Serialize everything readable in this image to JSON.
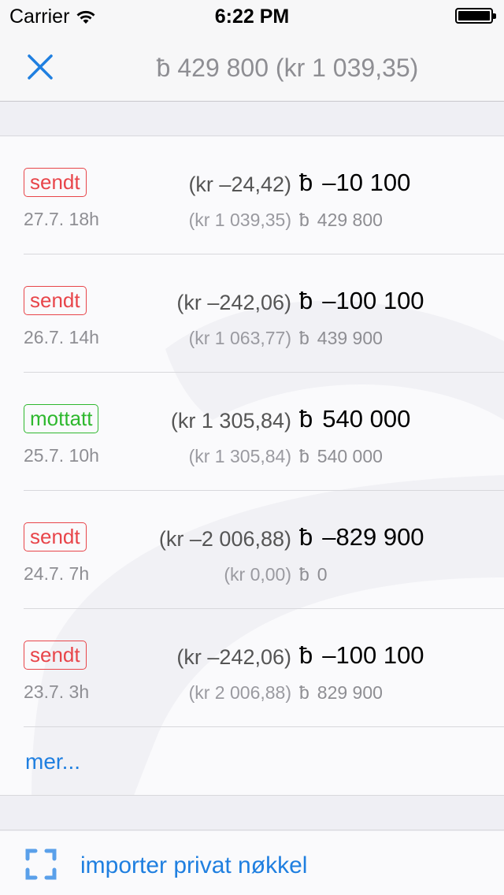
{
  "status": {
    "carrier": "Carrier",
    "time": "6:22 PM"
  },
  "nav": {
    "title": "ƀ 429 800 (kr 1 039,35)"
  },
  "colors": {
    "accent": "#1f7fe0",
    "sent": "#e8454a",
    "received": "#2eb82e"
  },
  "icons": {
    "close": "close-icon",
    "wifi": "wifi-icon",
    "battery": "battery-icon",
    "scan": "scan-qr-icon"
  },
  "transactions": [
    {
      "badge": "sendt",
      "type": "sent",
      "date": "27.7. 18h",
      "fiat": "(kr –24,42)",
      "symbol": "ƀ",
      "amount": "–10 100",
      "balance_fiat": "(kr 1 039,35)",
      "balance": "429 800"
    },
    {
      "badge": "sendt",
      "type": "sent",
      "date": "26.7. 14h",
      "fiat": "(kr –242,06)",
      "symbol": "ƀ",
      "amount": "–100 100",
      "balance_fiat": "(kr 1 063,77)",
      "balance": "439 900"
    },
    {
      "badge": "mottatt",
      "type": "received",
      "date": "25.7. 10h",
      "fiat": "(kr 1 305,84)",
      "symbol": "ƀ",
      "amount": "540 000",
      "balance_fiat": "(kr 1 305,84)",
      "balance": "540 000"
    },
    {
      "badge": "sendt",
      "type": "sent",
      "date": "24.7. 7h",
      "fiat": "(kr –2 006,88)",
      "symbol": "ƀ",
      "amount": "–829 900",
      "balance_fiat": "(kr 0,00)",
      "balance": "0"
    },
    {
      "badge": "sendt",
      "type": "sent",
      "date": "23.7. 3h",
      "fiat": "(kr –242,06)",
      "symbol": "ƀ",
      "amount": "–100 100",
      "balance_fiat": "(kr 2 006,88)",
      "balance": "829 900"
    }
  ],
  "more_label": "mer...",
  "import_label": "importer privat nøkkel"
}
